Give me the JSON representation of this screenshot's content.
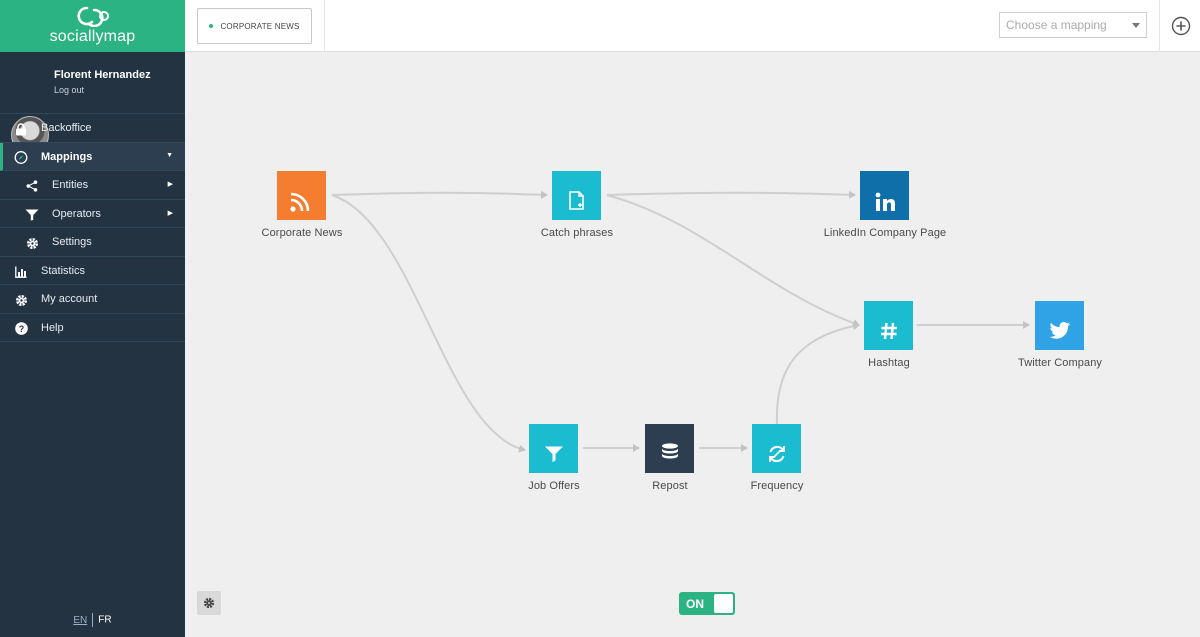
{
  "brand": {
    "name": "sociallymap"
  },
  "user": {
    "name": "Florent Hernandez",
    "logout": "Log out"
  },
  "nav": {
    "items": [
      {
        "label": "Backoffice",
        "icon": "lock-icon"
      },
      {
        "label": "Mappings",
        "icon": "compass-icon"
      },
      {
        "label": "Entities",
        "icon": "share-icon"
      },
      {
        "label": "Operators",
        "icon": "funnel-icon"
      },
      {
        "label": "Settings",
        "icon": "gear-icon"
      },
      {
        "label": "Statistics",
        "icon": "bar-chart-icon"
      },
      {
        "label": "My account",
        "icon": "gear-icon"
      },
      {
        "label": "Help",
        "icon": "question-icon"
      }
    ]
  },
  "lang": {
    "en": "EN",
    "fr": "FR"
  },
  "topbar": {
    "tab_label": "CORPORATE NEWS",
    "select_placeholder": "Choose a mapping"
  },
  "graph": {
    "nodes": [
      {
        "label": "Corporate News",
        "color": "#f47d30",
        "icon": "rss-icon"
      },
      {
        "label": "Catch phrases",
        "color": "#1bbcd0",
        "icon": "document-icon"
      },
      {
        "label": "LinkedIn Company Page",
        "color": "#0f6fa8",
        "icon": "linkedin-icon"
      },
      {
        "label": "Hashtag",
        "color": "#1bbcd0",
        "icon": "hashtag-icon"
      },
      {
        "label": "Twitter Company",
        "color": "#2fa3e6",
        "icon": "twitter-icon"
      },
      {
        "label": "Job Offers",
        "color": "#1bbcd0",
        "icon": "funnel-icon"
      },
      {
        "label": "Repost",
        "color": "#2c3e50",
        "icon": "database-icon"
      },
      {
        "label": "Frequency",
        "color": "#1bbcd0",
        "icon": "refresh-icon"
      }
    ]
  },
  "toggle": {
    "label": "ON"
  },
  "colors": {
    "accent": "#2bb384",
    "sidebar": "#243342",
    "canvas": "#efefef"
  }
}
